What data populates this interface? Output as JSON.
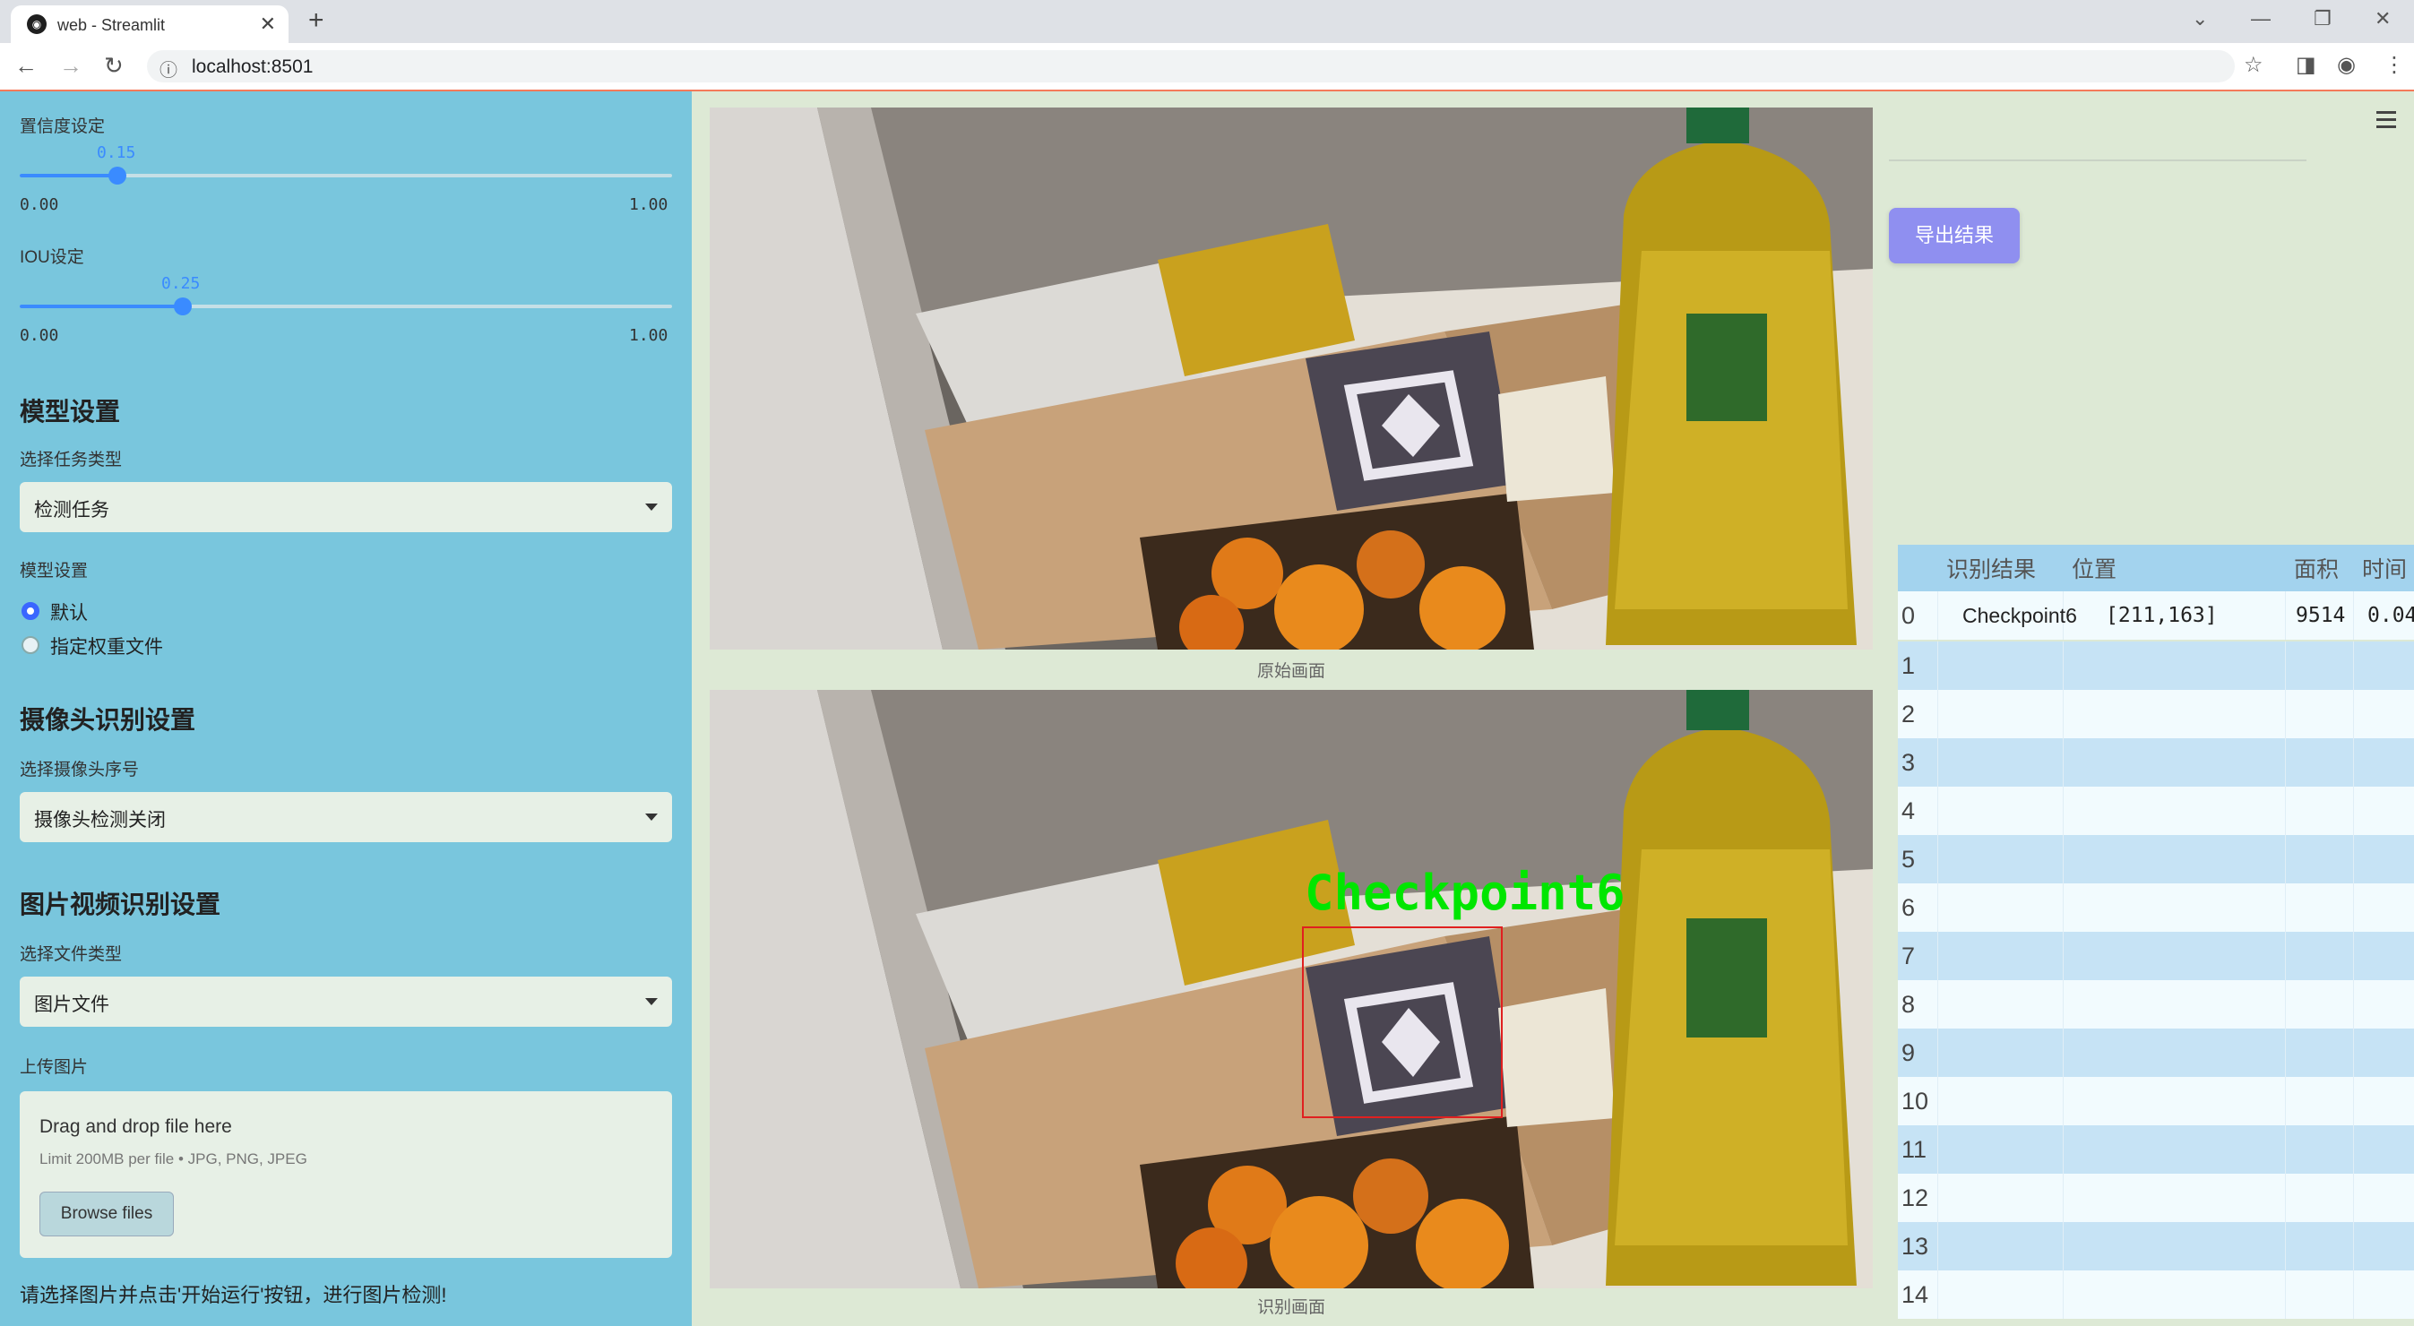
{
  "browser": {
    "tab_title": "web - Streamlit",
    "url": "localhost:8501"
  },
  "sidebar": {
    "confidence": {
      "label": "置信度设定",
      "value_text": "0.15",
      "value": 0.15,
      "min": "0.00",
      "max": "1.00"
    },
    "iou": {
      "label": "IOU设定",
      "value_text": "0.25",
      "value": 0.25,
      "min": "0.00",
      "max": "1.00"
    },
    "model_section": {
      "title": "模型设置",
      "task_label": "选择任务类型",
      "task_value": "检测任务",
      "weights_label": "模型设置",
      "radio_default": "默认",
      "radio_custom": "指定权重文件"
    },
    "camera_section": {
      "title": "摄像头识别设置",
      "camera_label": "选择摄像头序号",
      "camera_value": "摄像头检测关闭"
    },
    "media_section": {
      "title": "图片视频识别设置",
      "file_type_label": "选择文件类型",
      "file_type_value": "图片文件",
      "upload_label": "上传图片",
      "dropzone_text": "Drag and drop file here",
      "dropzone_limit": "Limit 200MB per file • JPG, PNG, JPEG",
      "browse_button": "Browse files"
    },
    "hint": "请选择图片并点击'开始运行'按钮，进行图片检测!"
  },
  "main": {
    "original_caption": "原始画面",
    "result_caption": "识别画面",
    "detection_label": "Checkpoint6",
    "accent_color": "#00e600",
    "box_color": "#e02020"
  },
  "right": {
    "export_button": "导出结果",
    "table": {
      "headers": [
        "识别结果",
        "位置",
        "面积",
        "时间"
      ],
      "rows": [
        {
          "index": "0",
          "result": "Checkpoint6",
          "position": "[211,163]",
          "area": "9514",
          "time": "0.04"
        },
        {
          "index": "1"
        },
        {
          "index": "2"
        },
        {
          "index": "3"
        },
        {
          "index": "4"
        },
        {
          "index": "5"
        },
        {
          "index": "6"
        },
        {
          "index": "7"
        },
        {
          "index": "8"
        },
        {
          "index": "9"
        },
        {
          "index": "10"
        },
        {
          "index": "11"
        },
        {
          "index": "12"
        },
        {
          "index": "13"
        },
        {
          "index": "14"
        }
      ]
    }
  }
}
